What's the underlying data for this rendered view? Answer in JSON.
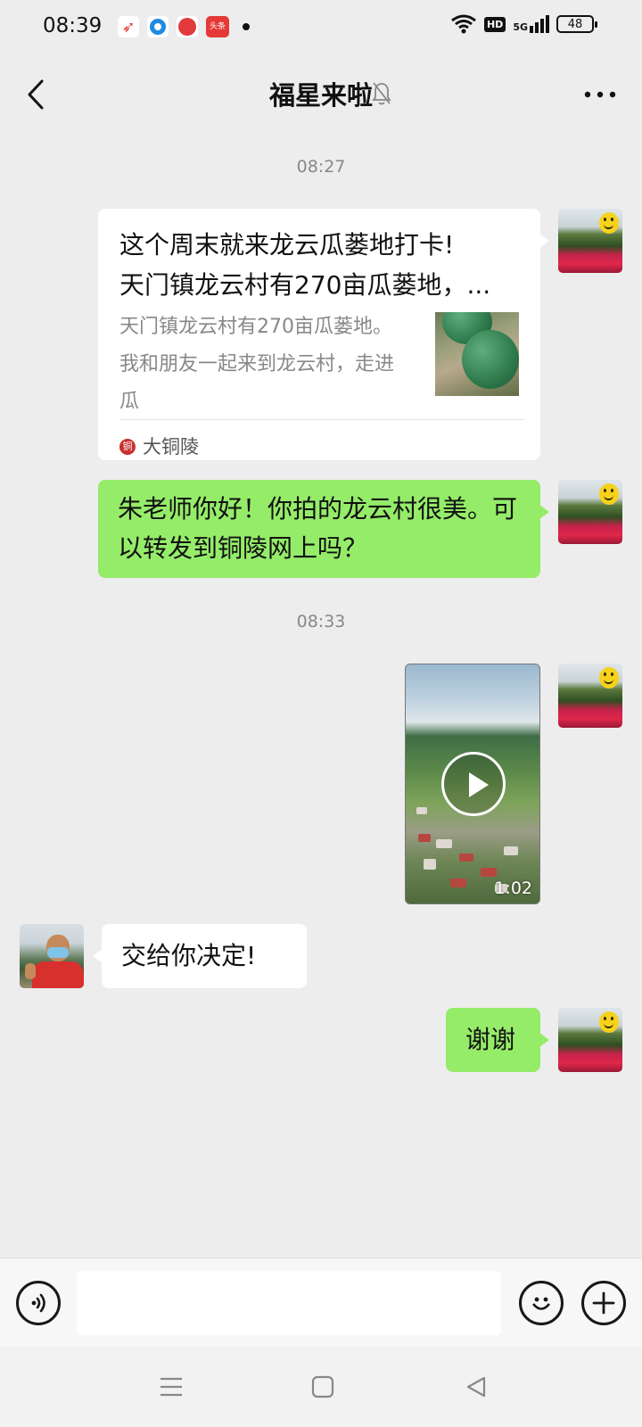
{
  "status_bar": {
    "time": "08:39",
    "notification_icons": [
      "compass-app-icon",
      "circle-app-icon",
      "red-circle-app-icon",
      "toutiao-app-icon"
    ],
    "toutiao_label": "头条",
    "network_badge": "HD",
    "signal_label": "5G",
    "battery_level": "48"
  },
  "header": {
    "title": "福星来啦",
    "muted": true
  },
  "messages": {
    "time_1": "08:27",
    "link_card": {
      "title_line_1": "这个周末就来龙云瓜蒌地打卡!",
      "title_line_2": "天门镇龙云村有270亩瓜蒌地，...",
      "description": "天门镇龙云村有270亩瓜蒌地。我和朋友一起来到龙云村，走进瓜",
      "source_logo_text": "铜",
      "source_name": "大铜陵"
    },
    "outgoing_1": "朱老师你好！你拍的龙云村很美。可以转发到铜陵网上吗？",
    "time_2": "08:33",
    "video": {
      "duration": "1:02"
    },
    "incoming_1": "交给你决定!",
    "outgoing_2": "谢谢"
  },
  "input_bar": {
    "voice_icon": "voice-wave-icon",
    "emoji_icon": "smiley-icon",
    "plus_icon": "plus-icon",
    "message_value": ""
  },
  "nav_bar": {
    "icons": [
      "menu-icon",
      "home-square-icon",
      "back-triangle-icon"
    ]
  },
  "colors": {
    "chat_background": "#ededed",
    "outgoing_bubble": "#95ec69",
    "incoming_bubble": "#ffffff",
    "timestamp_text": "#888888"
  }
}
